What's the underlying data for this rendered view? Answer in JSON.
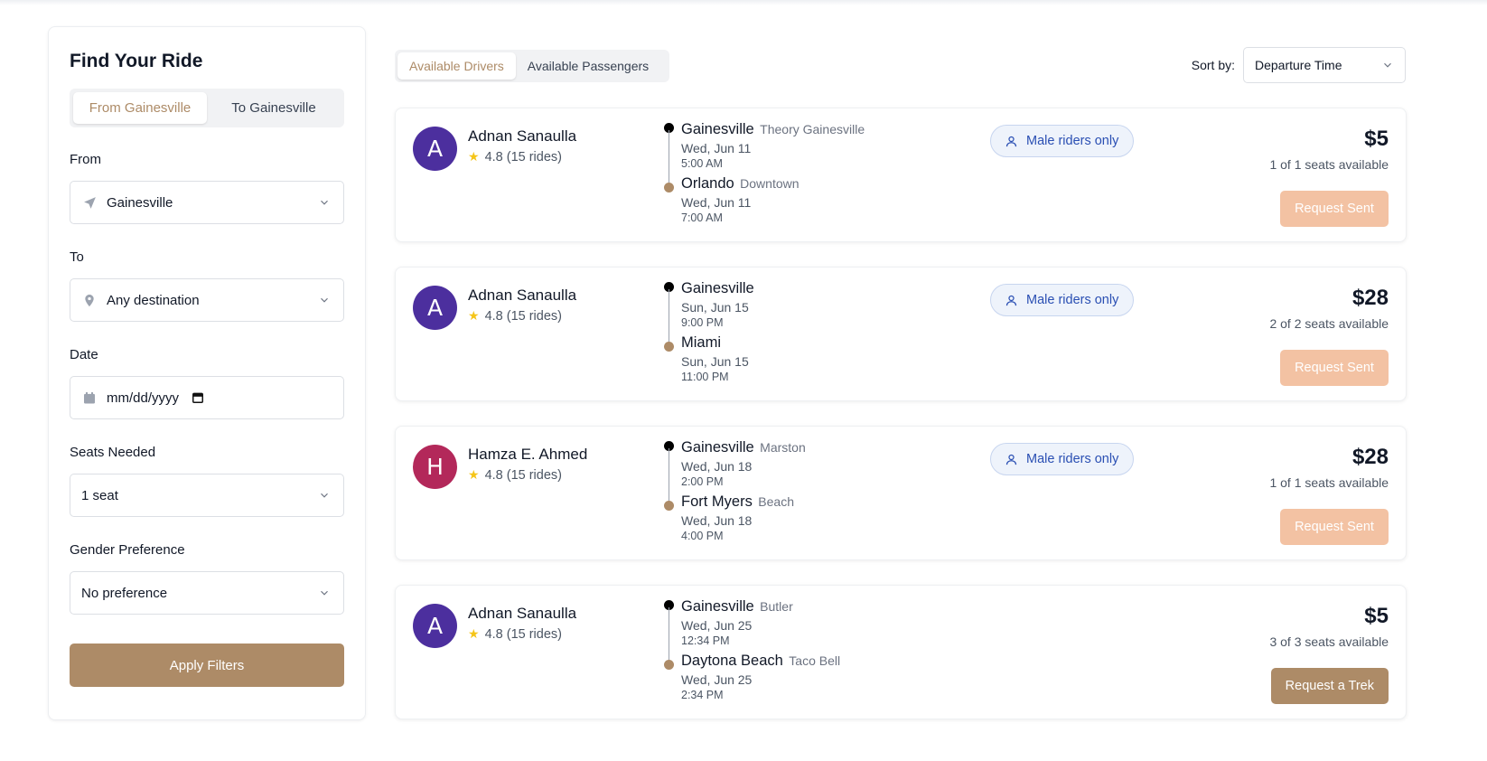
{
  "sidebar": {
    "title": "Find Your Ride",
    "direction_options": [
      "From Gainesville",
      "To Gainesville"
    ],
    "from": {
      "label": "From",
      "value": "Gainesville"
    },
    "to": {
      "label": "To",
      "value": "Any destination"
    },
    "date": {
      "label": "Date",
      "placeholder": "mm/dd/yyyy"
    },
    "seats": {
      "label": "Seats Needed",
      "value": "1 seat"
    },
    "gender": {
      "label": "Gender Preference",
      "value": "No preference"
    },
    "apply_label": "Apply Filters"
  },
  "tabs": [
    "Available Drivers",
    "Available Passengers"
  ],
  "sort": {
    "label": "Sort by:",
    "value": "Departure Time"
  },
  "rides": [
    {
      "avatar_letter": "A",
      "avatar_color": "#4c2f9e",
      "driver": "Adnan Sanaulla",
      "rating": "4.8 (15 rides)",
      "from_city": "Gainesville",
      "from_sub": "Theory Gainesville",
      "from_date": "Wed, Jun 11",
      "from_time": "5:00 AM",
      "to_city": "Orlando",
      "to_sub": "Downtown",
      "to_date": "Wed, Jun 11",
      "to_time": "7:00 AM",
      "preference": "Male riders only",
      "price": "$5",
      "seats": "1 of 1 seats available",
      "action": "Request Sent"
    },
    {
      "avatar_letter": "A",
      "avatar_color": "#4c2f9e",
      "driver": "Adnan Sanaulla",
      "rating": "4.8 (15 rides)",
      "from_city": "Gainesville",
      "from_sub": "",
      "from_date": "Sun, Jun 15",
      "from_time": "9:00 PM",
      "to_city": "Miami",
      "to_sub": "",
      "to_date": "Sun, Jun 15",
      "to_time": "11:00 PM",
      "preference": "Male riders only",
      "price": "$28",
      "seats": "2 of 2 seats available",
      "action": "Request Sent"
    },
    {
      "avatar_letter": "H",
      "avatar_color": "#b3285a",
      "driver": "Hamza E. Ahmed",
      "rating": "4.8 (15 rides)",
      "from_city": "Gainesville",
      "from_sub": "Marston",
      "from_date": "Wed, Jun 18",
      "from_time": "2:00 PM",
      "to_city": "Fort Myers",
      "to_sub": "Beach",
      "to_date": "Wed, Jun 18",
      "to_time": "4:00 PM",
      "preference": "Male riders only",
      "price": "$28",
      "seats": "1 of 1 seats available",
      "action": "Request Sent"
    },
    {
      "avatar_letter": "A",
      "avatar_color": "#4c2f9e",
      "driver": "Adnan Sanaulla",
      "rating": "4.8 (15 rides)",
      "from_city": "Gainesville",
      "from_sub": "Butler",
      "from_date": "Wed, Jun 25",
      "from_time": "12:34 PM",
      "to_city": "Daytona Beach",
      "to_sub": "Taco Bell",
      "to_date": "Wed, Jun 25",
      "to_time": "2:34 PM",
      "preference": "",
      "price": "$5",
      "seats": "3 of 3 seats available",
      "action": "Request a Trek"
    }
  ],
  "colors": {
    "accent": "#ad8b67",
    "request_sent": "#f3c2a3",
    "badge_text": "#2a4fb3"
  },
  "icons": {
    "from": "navigation-arrow-icon",
    "to": "map-pin-icon",
    "date": "calendar-icon",
    "chevron": "chevron-down-icon",
    "user": "user-icon",
    "star": "star-icon"
  }
}
